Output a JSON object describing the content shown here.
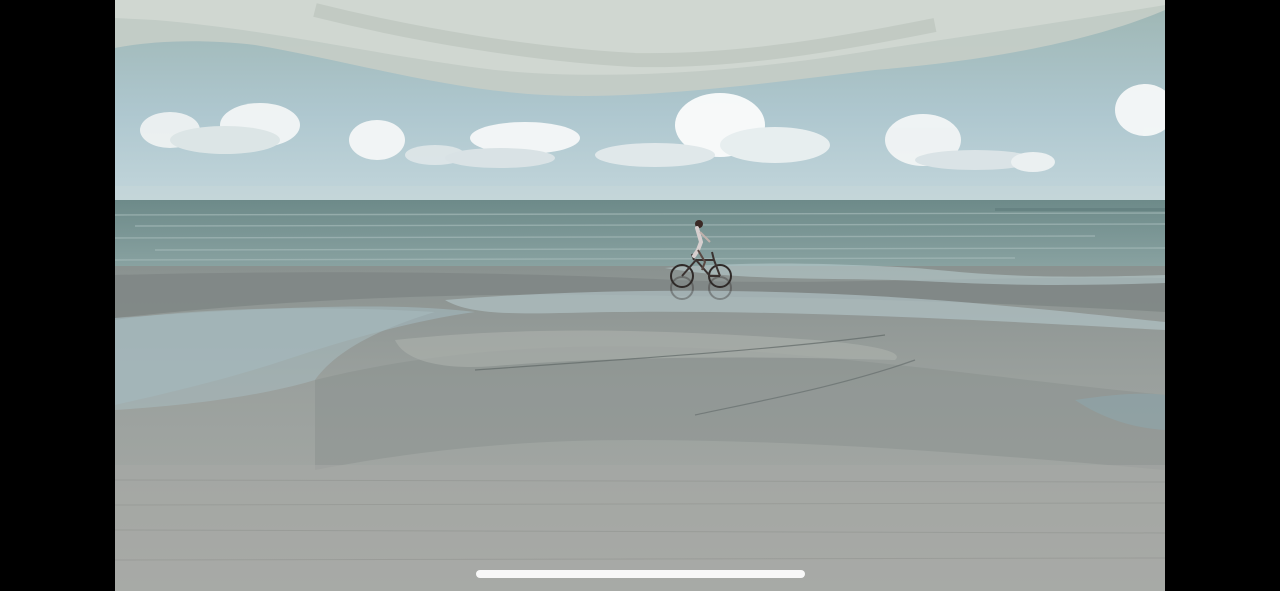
{
  "screen": {
    "orientation": "landscape",
    "mode": "fullscreen-media-viewer"
  },
  "media": {
    "kind": "photo",
    "scene": "beach",
    "subjects": [
      "child-riding-bicycle"
    ]
  },
  "colors": {
    "letterbox": "#000000",
    "sky_top": "#9fb7b6",
    "sky_bottom": "#b7cfd6",
    "sea": "#6f8c8c",
    "sand": "#9ea3a0",
    "wet_sand": "#7f898a",
    "tide_pool": "#a9bcc0",
    "home_indicator": "#ffffff"
  },
  "home_indicator": {
    "icon": "home-indicator-bar"
  }
}
